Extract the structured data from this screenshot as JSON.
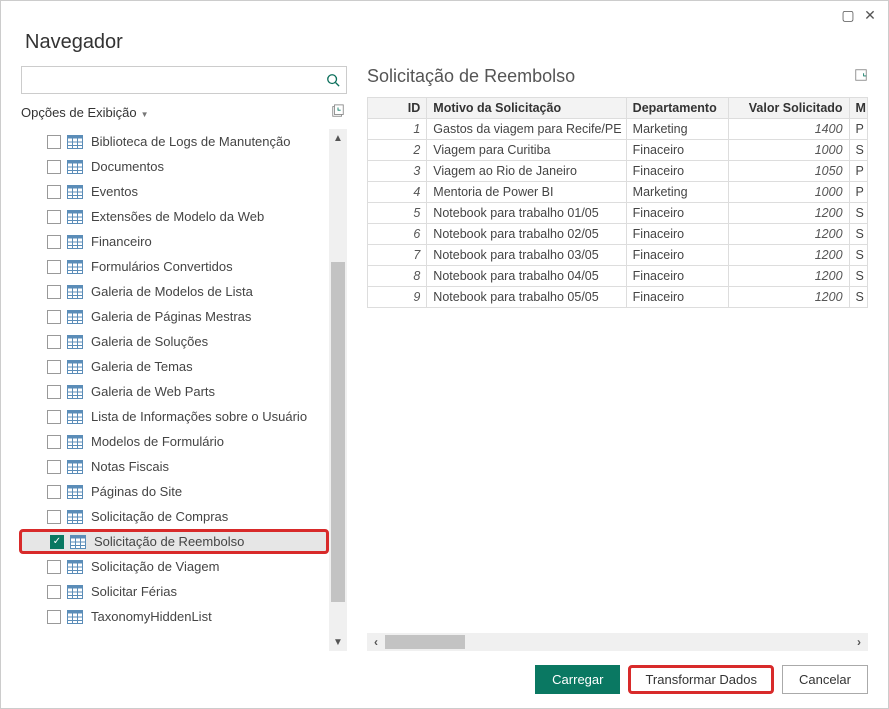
{
  "titlebar": {
    "maximize": "▢",
    "close": "✕"
  },
  "header": {
    "title": "Navegador"
  },
  "search": {
    "value": "",
    "placeholder": ""
  },
  "display_options": {
    "label": "Opções de Exibição"
  },
  "tree": {
    "items": [
      {
        "label": "Biblioteca de Logs de Manutenção",
        "checked": false
      },
      {
        "label": "Documentos",
        "checked": false
      },
      {
        "label": "Eventos",
        "checked": false
      },
      {
        "label": "Extensões de Modelo da Web",
        "checked": false
      },
      {
        "label": "Financeiro",
        "checked": false
      },
      {
        "label": "Formulários Convertidos",
        "checked": false
      },
      {
        "label": "Galeria de Modelos de Lista",
        "checked": false
      },
      {
        "label": "Galeria de Páginas Mestras",
        "checked": false
      },
      {
        "label": "Galeria de Soluções",
        "checked": false
      },
      {
        "label": "Galeria de Temas",
        "checked": false
      },
      {
        "label": "Galeria de Web Parts",
        "checked": false
      },
      {
        "label": "Lista de Informações sobre o Usuário",
        "checked": false
      },
      {
        "label": "Modelos de Formulário",
        "checked": false
      },
      {
        "label": "Notas Fiscais",
        "checked": false
      },
      {
        "label": "Páginas do Site",
        "checked": false
      },
      {
        "label": "Solicitação de Compras",
        "checked": false
      },
      {
        "label": "Solicitação de Reembolso",
        "checked": true,
        "selected": true
      },
      {
        "label": "Solicitação de Viagem",
        "checked": false
      },
      {
        "label": "Solicitar Férias",
        "checked": false
      },
      {
        "label": "TaxonomyHiddenList",
        "checked": false
      }
    ]
  },
  "preview": {
    "title": "Solicitação de Reembolso",
    "columns": {
      "id": "ID",
      "motivo": "Motivo da Solicitação",
      "dept": "Departamento",
      "valor": "Valor Solicitado",
      "m": "M"
    },
    "rows": [
      {
        "id": "1",
        "motivo": "Gastos da viagem para Recife/PE",
        "dept": "Marketing",
        "valor": "1400",
        "m": "P"
      },
      {
        "id": "2",
        "motivo": "Viagem para Curitiba",
        "dept": "Finaceiro",
        "valor": "1000",
        "m": "S"
      },
      {
        "id": "3",
        "motivo": "Viagem ao Rio de Janeiro",
        "dept": "Finaceiro",
        "valor": "1050",
        "m": "P"
      },
      {
        "id": "4",
        "motivo": "Mentoria de Power BI",
        "dept": "Marketing",
        "valor": "1000",
        "m": "P"
      },
      {
        "id": "5",
        "motivo": "Notebook para trabalho 01/05",
        "dept": "Finaceiro",
        "valor": "1200",
        "m": "S"
      },
      {
        "id": "6",
        "motivo": "Notebook para trabalho 02/05",
        "dept": "Finaceiro",
        "valor": "1200",
        "m": "S"
      },
      {
        "id": "7",
        "motivo": "Notebook para trabalho 03/05",
        "dept": "Finaceiro",
        "valor": "1200",
        "m": "S"
      },
      {
        "id": "8",
        "motivo": "Notebook para trabalho 04/05",
        "dept": "Finaceiro",
        "valor": "1200",
        "m": "S"
      },
      {
        "id": "9",
        "motivo": "Notebook para trabalho 05/05",
        "dept": "Finaceiro",
        "valor": "1200",
        "m": "S"
      }
    ]
  },
  "footer": {
    "carregar": "Carregar",
    "transformar": "Transformar Dados",
    "cancelar": "Cancelar"
  }
}
